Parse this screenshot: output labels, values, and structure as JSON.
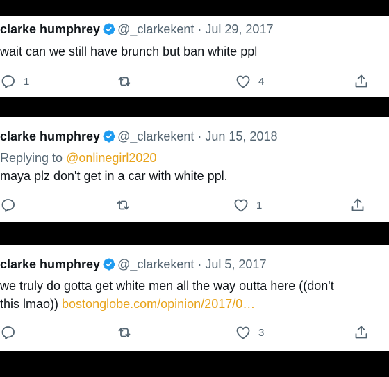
{
  "colors": {
    "background": "#000000",
    "card": "#ffffff",
    "text": "#0f1419",
    "muted": "#536471",
    "verified": "#1d9bf0",
    "link": "#e8a31a"
  },
  "tweets": [
    {
      "name": "clarke humphrey",
      "handle": "@_clarkekent",
      "date": "Jul 29, 2017",
      "reply_prefix": "",
      "reply_to": "",
      "text_lines": [
        "wait can we still have brunch but ban white ppl"
      ],
      "link": "",
      "replies": "1",
      "retweets": "",
      "likes": "4"
    },
    {
      "name": "clarke humphrey",
      "handle": "@_clarkekent",
      "date": "Jun 15, 2018",
      "reply_prefix": "Replying to",
      "reply_to": "@onlinegirl2020",
      "text_lines": [
        "maya plz don't get in a car with white ppl."
      ],
      "link": "",
      "replies": "",
      "retweets": "",
      "likes": "1"
    },
    {
      "name": "clarke humphrey",
      "handle": "@_clarkekent",
      "date": "Jul 5, 2017",
      "reply_prefix": "",
      "reply_to": "",
      "text_lines": [
        "we truly do gotta get white men all the way outta here ((don't",
        "this lmao))"
      ],
      "link": "bostonglobe.com/opinion/2017/0…",
      "replies": "",
      "retweets": "",
      "likes": "3"
    }
  ],
  "icons": {
    "verified": "verified-badge-icon",
    "reply": "reply-icon",
    "retweet": "retweet-icon",
    "like": "heart-icon",
    "share": "share-icon"
  }
}
